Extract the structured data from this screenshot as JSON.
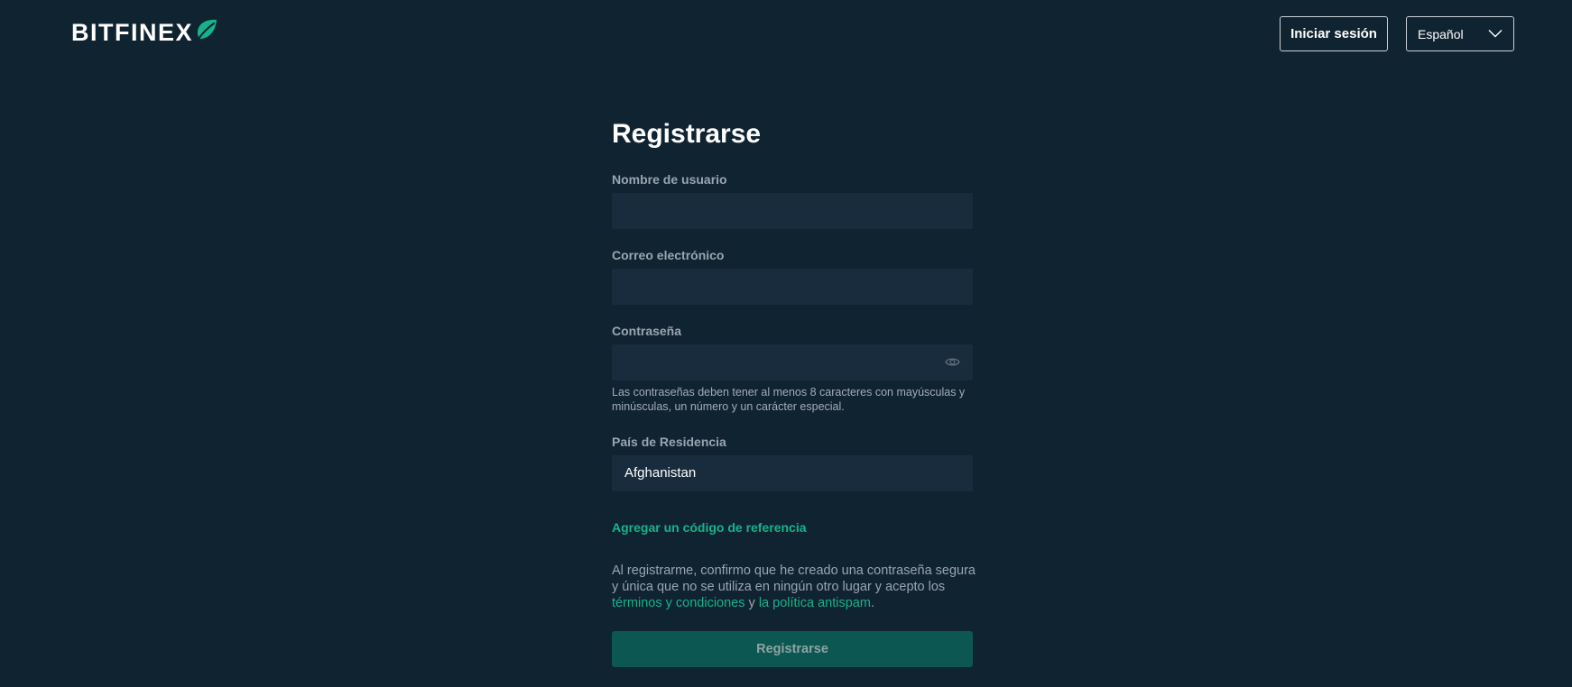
{
  "header": {
    "brand": "BITFINEX",
    "login_label": "Iniciar sesión",
    "language_selected": "Español"
  },
  "form": {
    "title": "Registrarse",
    "username": {
      "label": "Nombre de usuario",
      "value": "",
      "placeholder": ""
    },
    "email": {
      "label": "Correo electrónico",
      "value": "",
      "placeholder": ""
    },
    "password": {
      "label": "Contraseña",
      "value": "",
      "hint": "Las contraseñas deben tener al menos 8 caracteres con mayúsculas y minúsculas, un número y un carácter especial."
    },
    "country": {
      "label": "País de Residencia",
      "value": "Afghanistan"
    },
    "referral_link": "Agregar un código de referencia",
    "consent": {
      "text_before": "Al registrarme, confirmo que he creado una contraseña segura y única que no se utiliza en ningún otro lugar y acepto los ",
      "terms_link": "términos y condiciones",
      "connector": " y ",
      "antispam_link": "la política antispam",
      "text_after": "."
    },
    "submit_label": "Registrarse"
  },
  "colors": {
    "background": "#102331",
    "field_background": "#182c3e",
    "accent": "#16b38a",
    "submit_background": "#0d5752"
  },
  "icons": {
    "brand_leaf": "leaf-icon",
    "language_chevron": "chevron-down-icon",
    "password_toggle": "eye-icon"
  }
}
